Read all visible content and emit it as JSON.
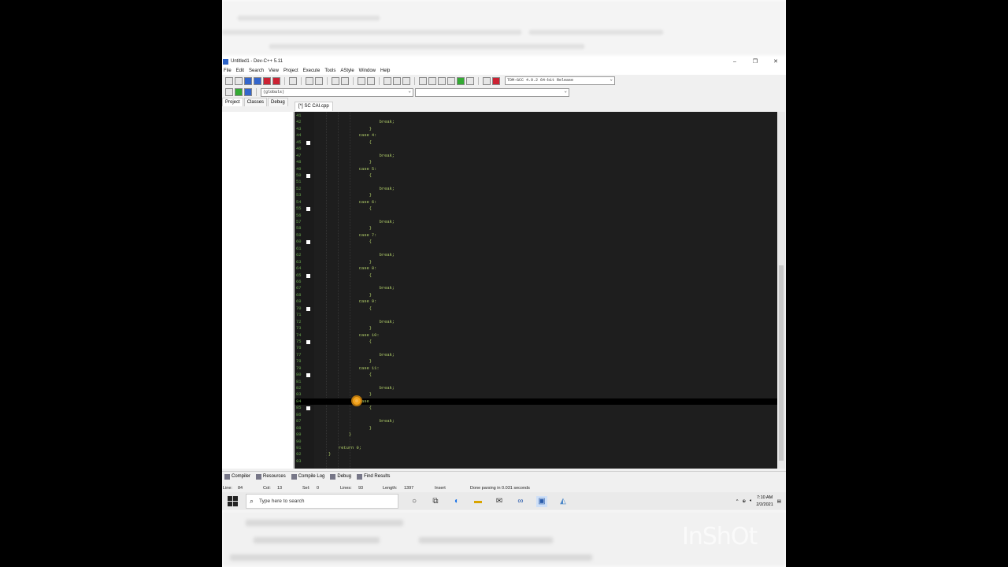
{
  "window": {
    "title": "Untitled1 - Dev-C++ 5.11",
    "minimize": "–",
    "maximize": "❐",
    "close": "✕"
  },
  "menu": [
    "File",
    "Edit",
    "Search",
    "View",
    "Project",
    "Execute",
    "Tools",
    "AStyle",
    "Window",
    "Help"
  ],
  "compiler_select": "TDM-GCC 4.9.2 64-bit Release",
  "scope_select": "(globals)",
  "panel_tabs": [
    "Project",
    "Classes",
    "Debug"
  ],
  "file_tab": "[*] SC CAI.cpp",
  "code_lines": [
    {
      "n": "41",
      "t": "",
      "fold": false
    },
    {
      "n": "42",
      "t": "                        break;",
      "fold": false
    },
    {
      "n": "43",
      "t": "                    }",
      "fold": false
    },
    {
      "n": "44",
      "t": "                case 4:",
      "fold": false
    },
    {
      "n": "45",
      "t": "                    {",
      "fold": true
    },
    {
      "n": "46",
      "t": "",
      "fold": false
    },
    {
      "n": "47",
      "t": "                        break;",
      "fold": false
    },
    {
      "n": "48",
      "t": "                    }",
      "fold": false
    },
    {
      "n": "49",
      "t": "                case 5:",
      "fold": false
    },
    {
      "n": "50",
      "t": "                    {",
      "fold": true
    },
    {
      "n": "51",
      "t": "",
      "fold": false
    },
    {
      "n": "52",
      "t": "                        break;",
      "fold": false
    },
    {
      "n": "53",
      "t": "                    }",
      "fold": false
    },
    {
      "n": "54",
      "t": "                case 6:",
      "fold": false
    },
    {
      "n": "55",
      "t": "                    {",
      "fold": true
    },
    {
      "n": "56",
      "t": "",
      "fold": false
    },
    {
      "n": "57",
      "t": "                        break;",
      "fold": false
    },
    {
      "n": "58",
      "t": "                    }",
      "fold": false
    },
    {
      "n": "59",
      "t": "                case 7:",
      "fold": false
    },
    {
      "n": "60",
      "t": "                    {",
      "fold": true
    },
    {
      "n": "61",
      "t": "",
      "fold": false
    },
    {
      "n": "62",
      "t": "                        break;",
      "fold": false
    },
    {
      "n": "63",
      "t": "                    }",
      "fold": false
    },
    {
      "n": "64",
      "t": "                case 8:",
      "fold": false
    },
    {
      "n": "65",
      "t": "                    {",
      "fold": true
    },
    {
      "n": "66",
      "t": "",
      "fold": false
    },
    {
      "n": "67",
      "t": "                        break;",
      "fold": false
    },
    {
      "n": "68",
      "t": "                    }",
      "fold": false
    },
    {
      "n": "69",
      "t": "                case 9:",
      "fold": false
    },
    {
      "n": "70",
      "t": "                    {",
      "fold": true
    },
    {
      "n": "71",
      "t": "",
      "fold": false
    },
    {
      "n": "72",
      "t": "                        break;",
      "fold": false
    },
    {
      "n": "73",
      "t": "                    }",
      "fold": false
    },
    {
      "n": "74",
      "t": "                case 10:",
      "fold": false
    },
    {
      "n": "75",
      "t": "                    {",
      "fold": true
    },
    {
      "n": "76",
      "t": "",
      "fold": false
    },
    {
      "n": "77",
      "t": "                        break;",
      "fold": false
    },
    {
      "n": "78",
      "t": "                    }",
      "fold": false
    },
    {
      "n": "79",
      "t": "                case 11:",
      "fold": false
    },
    {
      "n": "80",
      "t": "                    {",
      "fold": true
    },
    {
      "n": "81",
      "t": "",
      "fold": false
    },
    {
      "n": "82",
      "t": "                        break;",
      "fold": false
    },
    {
      "n": "83",
      "t": "                    }",
      "fold": false
    },
    {
      "n": "84",
      "t": "                case",
      "fold": false
    },
    {
      "n": "85",
      "t": "                    {",
      "fold": true
    },
    {
      "n": "86",
      "t": "",
      "fold": false
    },
    {
      "n": "87",
      "t": "                        break;",
      "fold": false
    },
    {
      "n": "88",
      "t": "                    }",
      "fold": false
    },
    {
      "n": "89",
      "t": "            }",
      "fold": false
    },
    {
      "n": "90",
      "t": "",
      "fold": false
    },
    {
      "n": "91",
      "t": "        return 0;",
      "fold": false
    },
    {
      "n": "92",
      "t": "    }",
      "fold": false
    },
    {
      "n": "93",
      "t": "",
      "fold": false
    }
  ],
  "current_line_index": 43,
  "bottom_tabs": [
    "Compiler",
    "Resources",
    "Compile Log",
    "Debug",
    "Find Results"
  ],
  "status": {
    "line_label": "Line:",
    "line": "84",
    "col_label": "Col:",
    "col": "13",
    "sel_label": "Sel:",
    "sel": "0",
    "lines_label": "Lines:",
    "lines": "93",
    "length_label": "Length:",
    "length": "1397",
    "mode": "Insert",
    "message": "Done parsing in 0.031 seconds"
  },
  "taskbar": {
    "search_placeholder": "Type here to search",
    "time": "7:10 AM",
    "date": "2/2/2021"
  },
  "watermark": "InShOt"
}
